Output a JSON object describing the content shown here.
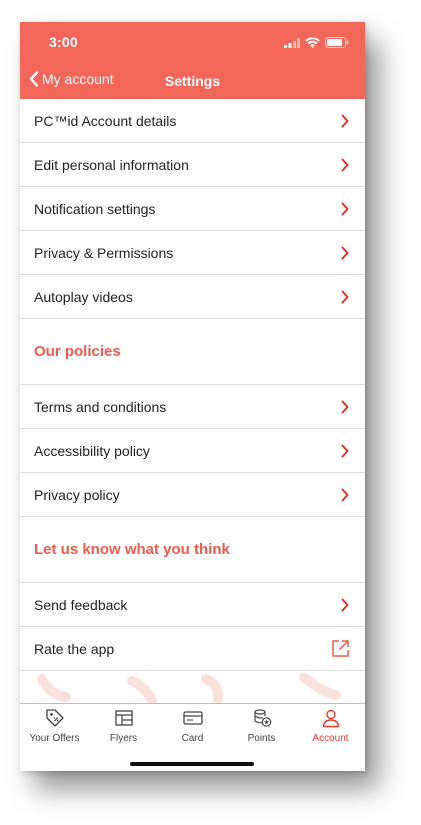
{
  "status_bar": {
    "time": "3:00"
  },
  "nav": {
    "back_label": "My account",
    "title": "Settings"
  },
  "colors": {
    "header": "#f5665a",
    "accent": "#ee5a4c",
    "chevron": "#e0342a",
    "divider": "#dedede"
  },
  "account_items": [
    {
      "label": "PC™id Account details",
      "icon": "chevron-right-icon"
    },
    {
      "label": "Edit personal information",
      "icon": "chevron-right-icon"
    },
    {
      "label": "Notification settings",
      "icon": "chevron-right-icon"
    },
    {
      "label": "Privacy & Permissions",
      "icon": "chevron-right-icon"
    },
    {
      "label": "Autoplay videos",
      "icon": "chevron-right-icon"
    }
  ],
  "policies": {
    "title": "Our policies",
    "items": [
      {
        "label": "Terms and conditions",
        "icon": "chevron-right-icon"
      },
      {
        "label": "Accessibility policy",
        "icon": "chevron-right-icon"
      },
      {
        "label": "Privacy policy",
        "icon": "chevron-right-icon"
      }
    ]
  },
  "feedback": {
    "title": "Let us know what you think",
    "items": [
      {
        "label": "Send feedback",
        "icon": "chevron-right-icon"
      },
      {
        "label": "Rate the app",
        "icon": "external-link-icon"
      }
    ]
  },
  "tabs": [
    {
      "label": "Your Offers",
      "icon": "tag-icon",
      "active": false
    },
    {
      "label": "Flyers",
      "icon": "flyer-icon",
      "active": false
    },
    {
      "label": "Card",
      "icon": "card-icon",
      "active": false
    },
    {
      "label": "Points",
      "icon": "points-icon",
      "active": false
    },
    {
      "label": "Account",
      "icon": "account-icon",
      "active": true
    }
  ]
}
